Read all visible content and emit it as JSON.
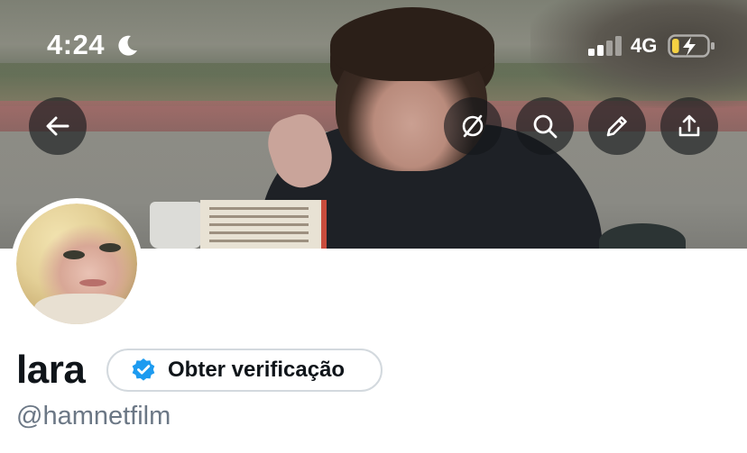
{
  "status_bar": {
    "time": "4:24",
    "moon_icon": "moon-icon",
    "signal_icon": "signal-bars-icon",
    "network": "4G",
    "battery_icon": "battery-charging-icon",
    "battery_level": 0.2,
    "battery_color": "#f5d142"
  },
  "header": {
    "back_icon": "arrow-left-icon",
    "actions": [
      "translate-off-icon",
      "search-icon",
      "edit-icon",
      "share-icon"
    ]
  },
  "profile": {
    "name": "lara",
    "verify_label": "Obter verificação",
    "verify_icon": "verified-badge-icon",
    "verify_color": "#1d9bf0",
    "handle": "@hamnetfilm"
  },
  "colors": {
    "text_primary": "#0f1419",
    "text_secondary": "#6b7785",
    "button_border": "#d3d9de"
  }
}
